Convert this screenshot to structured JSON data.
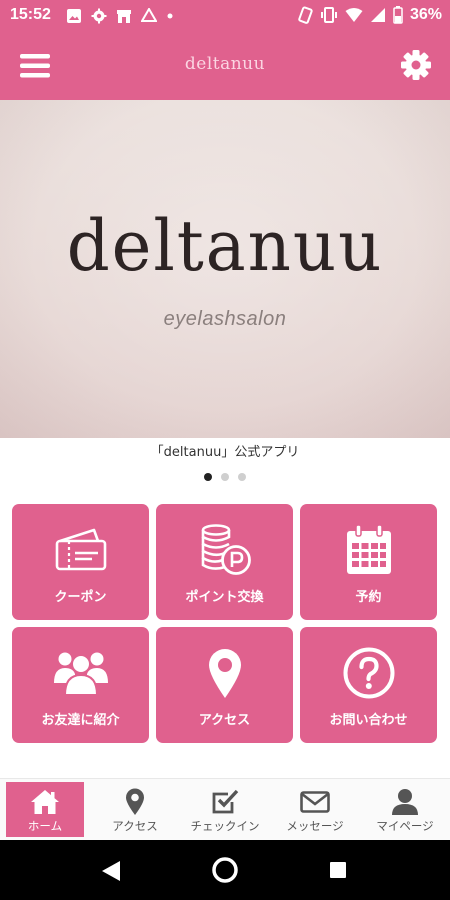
{
  "status_bar": {
    "time": "15:52",
    "battery_percent": "36%"
  },
  "header": {
    "title": "deltanuu",
    "menu_icon": "menu-icon",
    "settings_icon": "gear-icon"
  },
  "banner": {
    "logo_text": "deltanuu",
    "subtitle": "eyelashsalon",
    "caption": "「deltanuu」公式アプリ",
    "slide_count": 3,
    "active_slide": 1
  },
  "tiles": [
    {
      "label": "クーポン",
      "icon": "ticket-icon"
    },
    {
      "label": "ポイント交換",
      "icon": "coins-icon"
    },
    {
      "label": "予約",
      "icon": "calendar-icon"
    },
    {
      "label": "お友達に紹介",
      "icon": "friends-icon"
    },
    {
      "label": "アクセス",
      "icon": "location-pin-icon"
    },
    {
      "label": "お問い合わせ",
      "icon": "question-icon"
    }
  ],
  "bottom_nav": [
    {
      "label": "ホーム",
      "icon": "home-icon",
      "active": true
    },
    {
      "label": "アクセス",
      "icon": "location-pin-icon",
      "active": false
    },
    {
      "label": "チェックイン",
      "icon": "checkbox-icon",
      "active": false
    },
    {
      "label": "メッセージ",
      "icon": "envelope-icon",
      "active": false
    },
    {
      "label": "マイページ",
      "icon": "user-icon",
      "active": false
    }
  ],
  "colors": {
    "brand": "#e0618e",
    "nav_background": "#fafafa",
    "system_nav": "#000000"
  }
}
